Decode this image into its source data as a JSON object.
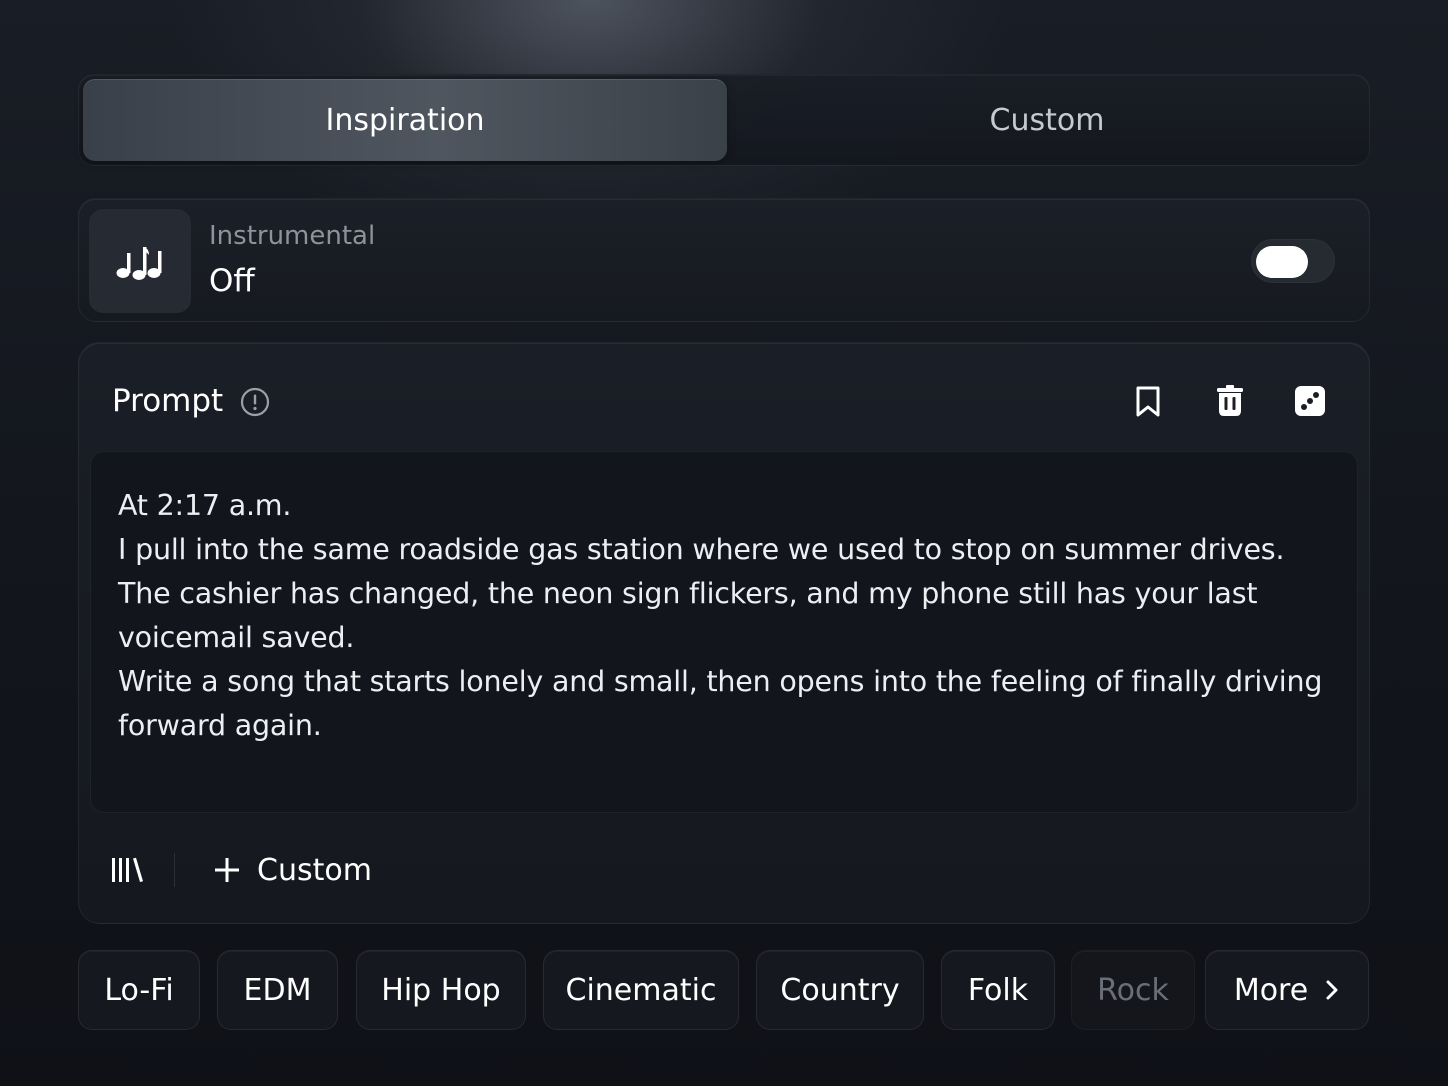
{
  "tabs": [
    {
      "label": "Inspiration",
      "active": true
    },
    {
      "label": "Custom",
      "active": false
    }
  ],
  "instrumental": {
    "label": "Instrumental",
    "value": "Off",
    "icon": "music-notes-icon",
    "toggle_on": false
  },
  "prompt": {
    "title": "Prompt",
    "info_icon": "info-icon",
    "actions": [
      "bookmark-icon",
      "trash-icon",
      "dice-icon"
    ],
    "text": "At 2:17 a.m.\nI pull into the same roadside gas station where we used to stop on summer drives.\nThe cashier has changed, the neon sign flickers, and my phone still has your last voicemail saved.\nWrite a song that starts lonely and small, then opens into the feeling of finally driving forward again.",
    "library_icon": "library-icon",
    "add_custom_label": "Custom"
  },
  "genres": [
    {
      "label": "Lo-Fi",
      "dimmed": false
    },
    {
      "label": "EDM",
      "dimmed": false
    },
    {
      "label": "Hip Hop",
      "dimmed": false
    },
    {
      "label": "Cinematic",
      "dimmed": false
    },
    {
      "label": "Country",
      "dimmed": false
    },
    {
      "label": "Folk",
      "dimmed": false
    },
    {
      "label": "Rock",
      "dimmed": true
    }
  ],
  "more_label": "More",
  "colors": {
    "background": "#13161d",
    "panel": "#1a1e26",
    "active_tab": "#4f565f",
    "text": "#ffffff",
    "muted_text": "#8d929b"
  }
}
